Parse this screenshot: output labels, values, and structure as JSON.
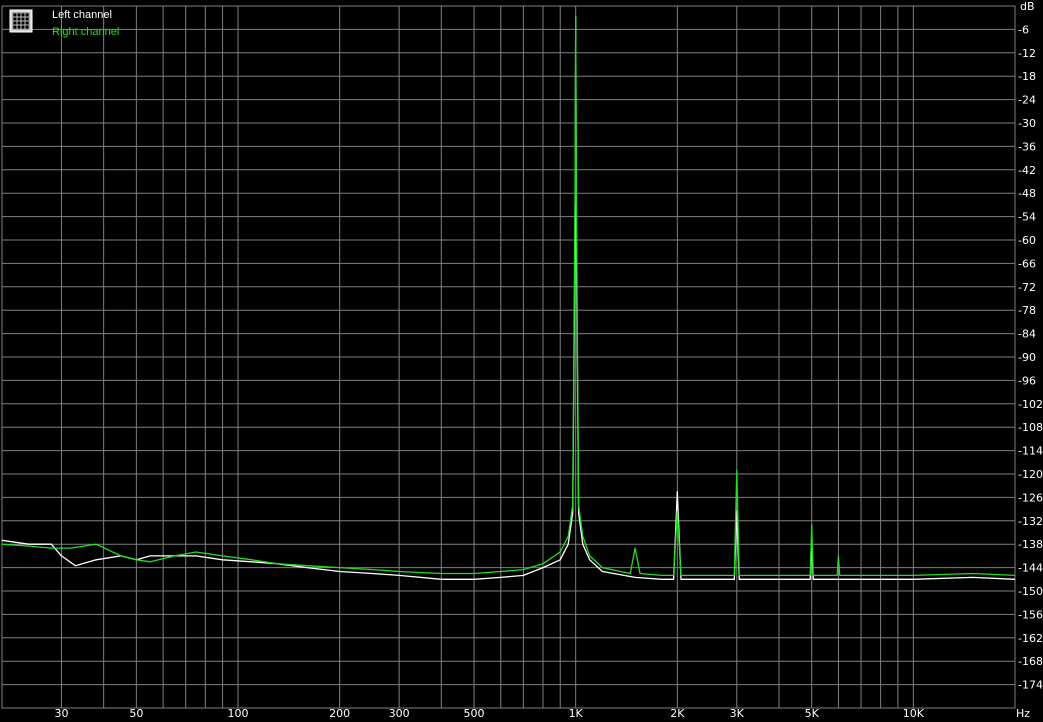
{
  "colors": {
    "background": "#000000",
    "grid": "#808080",
    "left_channel": "#ffffff",
    "right_channel": "#22dd22",
    "text": "#ffffff"
  },
  "legend": {
    "icon": "grid-icon",
    "left_label": "Left channel",
    "right_label": "Right channel"
  },
  "chart_data": {
    "type": "line",
    "title": "",
    "xlabel": "Hz",
    "ylabel": "dB",
    "x_scale": "log",
    "xlim": [
      20,
      20000
    ],
    "ylim": [
      -180,
      0
    ],
    "grid": true,
    "legend_position": "top-left",
    "x_ticks": [
      {
        "value": 30,
        "label": "30"
      },
      {
        "value": 50,
        "label": "50"
      },
      {
        "value": 100,
        "label": "100"
      },
      {
        "value": 200,
        "label": "200"
      },
      {
        "value": 300,
        "label": "300"
      },
      {
        "value": 500,
        "label": "500"
      },
      {
        "value": 1000,
        "label": "1K"
      },
      {
        "value": 2000,
        "label": "2K"
      },
      {
        "value": 3000,
        "label": "3K"
      },
      {
        "value": 5000,
        "label": "5K"
      },
      {
        "value": 10000,
        "label": "10K"
      }
    ],
    "y_ticks": [
      -6,
      -12,
      -18,
      -24,
      -30,
      -36,
      -42,
      -48,
      -54,
      -60,
      -66,
      -72,
      -78,
      -84,
      -90,
      -96,
      -102,
      -108,
      -114,
      -120,
      -126,
      -132,
      -138,
      -144,
      -150,
      -156,
      -162,
      -168,
      -174
    ],
    "series": [
      {
        "name": "Left channel",
        "color": "#ffffff",
        "points": [
          [
            20,
            -137
          ],
          [
            24,
            -138
          ],
          [
            28,
            -138
          ],
          [
            30,
            -141
          ],
          [
            33,
            -143.5
          ],
          [
            38,
            -142
          ],
          [
            45,
            -141
          ],
          [
            50,
            -142
          ],
          [
            55,
            -141
          ],
          [
            65,
            -141
          ],
          [
            75,
            -141
          ],
          [
            90,
            -142
          ],
          [
            110,
            -142.5
          ],
          [
            130,
            -143
          ],
          [
            160,
            -144
          ],
          [
            200,
            -145
          ],
          [
            250,
            -145.5
          ],
          [
            300,
            -146
          ],
          [
            400,
            -147
          ],
          [
            500,
            -147
          ],
          [
            600,
            -146.5
          ],
          [
            700,
            -146
          ],
          [
            800,
            -144
          ],
          [
            900,
            -142
          ],
          [
            950,
            -138
          ],
          [
            980,
            -130
          ],
          [
            995,
            -60
          ],
          [
            1000,
            -3
          ],
          [
            1005,
            -60
          ],
          [
            1020,
            -130
          ],
          [
            1050,
            -138
          ],
          [
            1100,
            -142
          ],
          [
            1200,
            -145
          ],
          [
            1500,
            -146.5
          ],
          [
            1800,
            -147
          ],
          [
            1950,
            -147
          ],
          [
            2000,
            -124.5
          ],
          [
            2050,
            -147
          ],
          [
            2500,
            -147
          ],
          [
            2950,
            -147
          ],
          [
            3000,
            -129.5
          ],
          [
            3050,
            -147
          ],
          [
            4000,
            -147
          ],
          [
            4950,
            -147
          ],
          [
            5000,
            -137
          ],
          [
            5050,
            -147
          ],
          [
            7000,
            -147
          ],
          [
            10000,
            -147
          ],
          [
            15000,
            -146.5
          ],
          [
            20000,
            -147
          ]
        ]
      },
      {
        "name": "Right channel",
        "color": "#22dd22",
        "points": [
          [
            20,
            -138
          ],
          [
            24,
            -138.5
          ],
          [
            28,
            -139
          ],
          [
            32,
            -139
          ],
          [
            38,
            -138
          ],
          [
            45,
            -141
          ],
          [
            50,
            -142
          ],
          [
            55,
            -142.5
          ],
          [
            65,
            -141
          ],
          [
            75,
            -140
          ],
          [
            90,
            -141
          ],
          [
            110,
            -142
          ],
          [
            130,
            -143
          ],
          [
            160,
            -143.5
          ],
          [
            200,
            -144
          ],
          [
            250,
            -144.5
          ],
          [
            300,
            -145
          ],
          [
            400,
            -145.5
          ],
          [
            500,
            -145.5
          ],
          [
            600,
            -145
          ],
          [
            700,
            -144.5
          ],
          [
            800,
            -143
          ],
          [
            900,
            -140
          ],
          [
            950,
            -136
          ],
          [
            980,
            -128
          ],
          [
            995,
            -50
          ],
          [
            1000,
            -2.5
          ],
          [
            1005,
            -50
          ],
          [
            1020,
            -128
          ],
          [
            1050,
            -136
          ],
          [
            1100,
            -141
          ],
          [
            1200,
            -144
          ],
          [
            1450,
            -145.5
          ],
          [
            1500,
            -139
          ],
          [
            1550,
            -145.5
          ],
          [
            1800,
            -146
          ],
          [
            1950,
            -146
          ],
          [
            2000,
            -129.5
          ],
          [
            2050,
            -146
          ],
          [
            2500,
            -146
          ],
          [
            2950,
            -146
          ],
          [
            3000,
            -119
          ],
          [
            3050,
            -146
          ],
          [
            4000,
            -146
          ],
          [
            4950,
            -146
          ],
          [
            5000,
            -133
          ],
          [
            5050,
            -146
          ],
          [
            5950,
            -146
          ],
          [
            6000,
            -141
          ],
          [
            6050,
            -146
          ],
          [
            7000,
            -146
          ],
          [
            10000,
            -146
          ],
          [
            15000,
            -145.5
          ],
          [
            20000,
            -146
          ]
        ]
      }
    ]
  }
}
